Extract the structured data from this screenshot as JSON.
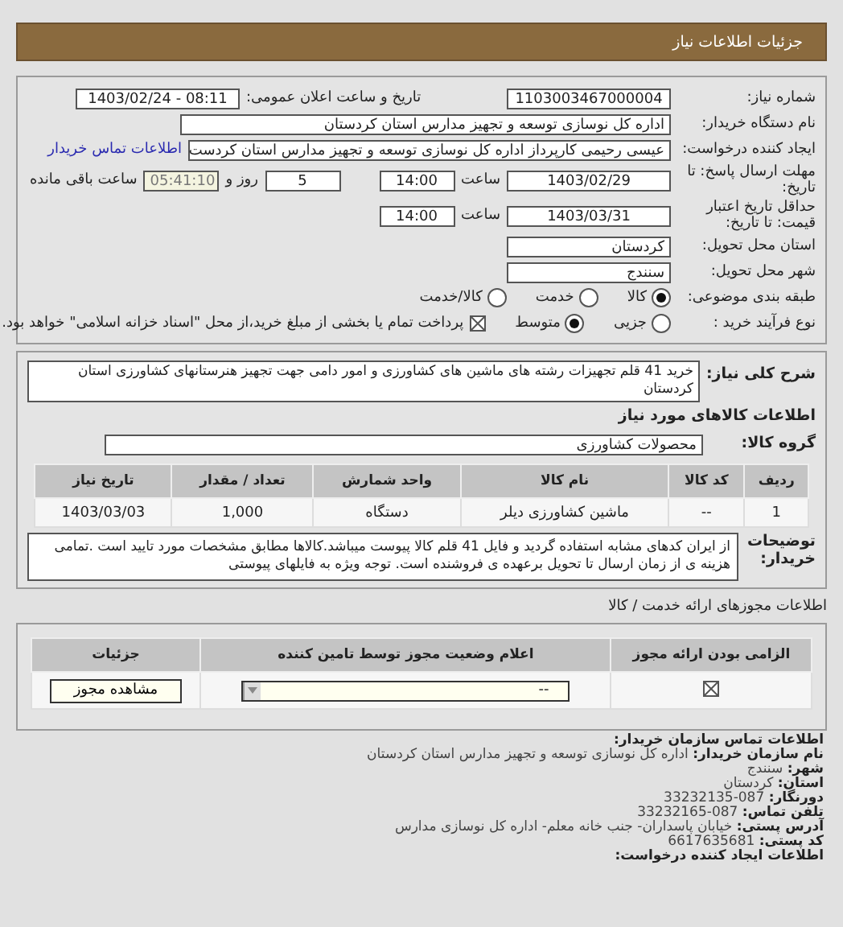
{
  "header": {
    "title": "جزئیات اطلاعات نیاز"
  },
  "need_number": {
    "label": "شماره نیاز:",
    "value": "1103003467000004"
  },
  "announce": {
    "label": "تاریخ و ساعت اعلان عمومی:",
    "value": "1403/02/24 - 08:11"
  },
  "buyer_org": {
    "label": "نام دستگاه خریدار:",
    "value": "اداره کل نوسازی  توسعه و تجهیز مدارس استان کردستان"
  },
  "requester": {
    "label": "ایجاد کننده درخواست:",
    "value": "عیسی رحیمی کارپرداز اداره کل نوسازی  توسعه و تجهیز مدارس استان کردست",
    "link": "اطلاعات تماس خریدار"
  },
  "deadline": {
    "label": "مهلت ارسال پاسخ: تا تاریخ:",
    "date": "1403/02/29",
    "time_label": "ساعت",
    "time": "14:00",
    "days": "5",
    "days_label": "روز و",
    "remaining": "05:41:10",
    "remaining_label": "ساعت باقی مانده"
  },
  "validity": {
    "label": "حداقل تاریخ اعتبار قیمت: تا تاریخ:",
    "date": "1403/03/31",
    "time_label": "ساعت",
    "time": "14:00"
  },
  "province": {
    "label": "استان محل تحویل:",
    "value": "کردستان"
  },
  "city": {
    "label": "شهر محل تحویل:",
    "value": "سنندج"
  },
  "category": {
    "label": "طبقه بندی موضوعی:",
    "options": [
      {
        "label": "کالا",
        "selected": true
      },
      {
        "label": "خدمت",
        "selected": false
      },
      {
        "label": "کالا/خدمت",
        "selected": false
      }
    ]
  },
  "process": {
    "label": "نوع فرآیند خرید :",
    "options": [
      {
        "label": "جزیی",
        "selected": false
      },
      {
        "label": "متوسط",
        "selected": true
      }
    ],
    "treasury": {
      "checked": true,
      "text": "پرداخت تمام یا بخشی از مبلغ خرید،از محل \"اسناد خزانه اسلامی\" خواهد بود."
    }
  },
  "description": {
    "label": "شرح کلی نیاز:",
    "value": "خرید 41 قلم تجهیزات رشته های ماشین های کشاورزی و امور دامی جهت تجهیز هنرستانهای کشاورزی استان کردستان"
  },
  "goods_title": "اطلاعات کالاهای مورد نیاز",
  "goods_group": {
    "label": "گروه کالا:",
    "value": "محصولات کشاورزی"
  },
  "goods_table": {
    "columns": [
      "ردیف",
      "کد کالا",
      "نام کالا",
      "واحد شمارش",
      "تعداد / مقدار",
      "تاریخ نیاز"
    ],
    "rows": [
      [
        "1",
        "--",
        "ماشین کشاورزی دیلر",
        "دستگاه",
        "1,000",
        "1403/03/03"
      ]
    ]
  },
  "buyer_notes": {
    "label": "توضیحات خریدار:",
    "value": "از ایران کدهای مشابه استفاده گردید و فایل 41 قلم کالا پیوست میباشد.کالاها مطابق مشخصات مورد تایید است .تمامی هزینه ی از زمان ارسال تا تحویل برعهده ی فروشنده است. توجه ویژه به فایلهای پیوستی"
  },
  "permits_title": "اطلاعات مجوزهای ارائه خدمت / کالا",
  "permits_table": {
    "columns": [
      "الزامی بودن ارائه مجوز",
      "اعلام وضعیت مجوز توسط تامین کننده",
      "جزئیات"
    ],
    "rows": [
      {
        "required": true,
        "status": "--",
        "button": "مشاهده مجوز"
      }
    ]
  },
  "contact": {
    "title": "اطلاعات تماس سازمان خریدار:",
    "lines": [
      {
        "label": "نام سازمان خریدار:",
        "value": "اداره کل نوسازی توسعه و تجهیز مدارس استان کردستان"
      },
      {
        "label": "شهر:",
        "value": "سنندج"
      },
      {
        "label": "استان:",
        "value": "کردستان"
      },
      {
        "label": "دورنگار:",
        "value": "087-33232135"
      },
      {
        "label": "تلفن تماس:",
        "value": "087-33232165"
      },
      {
        "label": "آدرس پستی:",
        "value": "خیابان پاسداران- جنب خانه معلم- اداره کل نوسازی مدارس"
      },
      {
        "label": "کد پستی:",
        "value": "6617635681"
      }
    ],
    "next_title": "اطلاعات ایجاد کننده درخواست:"
  }
}
